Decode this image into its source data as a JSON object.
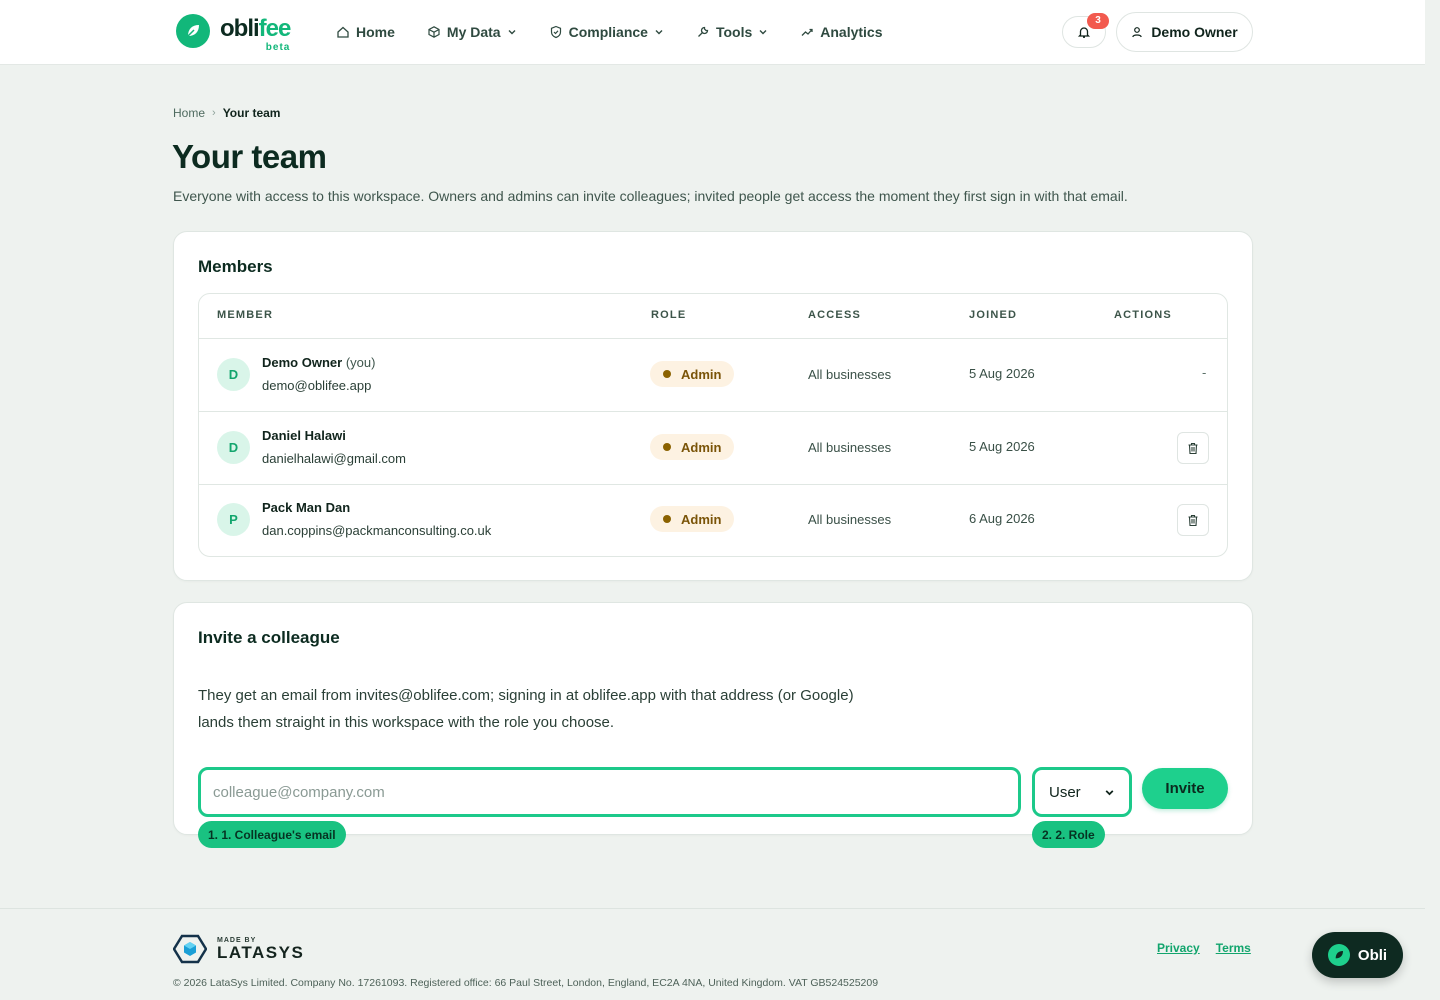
{
  "header": {
    "logo_word_a": "obli",
    "logo_word_b": "fee",
    "logo_beta": "beta",
    "nav": [
      {
        "label": "Home"
      },
      {
        "label": "My Data"
      },
      {
        "label": "Compliance"
      },
      {
        "label": "Tools"
      },
      {
        "label": "Analytics"
      }
    ],
    "notification_count": "3",
    "user_label": "Demo Owner"
  },
  "breadcrumb": {
    "home": "Home",
    "separator": "›",
    "current": "Your team"
  },
  "page": {
    "title": "Your team",
    "subtitle": "Everyone with access to this workspace. Owners and admins can invite colleagues; invited people get access the moment they first sign in with that email."
  },
  "members": {
    "title": "Members",
    "columns": [
      "MEMBER",
      "ROLE",
      "ACCESS",
      "JOINED",
      "ACTIONS"
    ],
    "rows": [
      {
        "initial": "D",
        "name": "Demo Owner",
        "you": "(you)",
        "email": "demo@oblifee.app",
        "role": "Admin",
        "access": "All businesses",
        "joined": "5 Aug 2026",
        "action": "-"
      },
      {
        "initial": "D",
        "name": "Daniel Halawi",
        "you": "",
        "email": "danielhalawi@gmail.com",
        "role": "Admin",
        "access": "All businesses",
        "joined": "5 Aug 2026",
        "action": "delete"
      },
      {
        "initial": "P",
        "name": "Pack Man Dan",
        "you": "",
        "email": "dan.coppins@packmanconsulting.co.uk",
        "role": "Admin",
        "access": "All businesses",
        "joined": "6 Aug 2026",
        "action": "delete"
      }
    ]
  },
  "invite": {
    "title": "Invite a colleague",
    "description": "They get an email from invites@oblifee.com; signing in at oblifee.app with that address (or Google) lands them straight in this workspace with the role you choose.",
    "email_placeholder": "colleague@company.com",
    "email_value": "",
    "role_selected": "User",
    "button_label": "Invite",
    "tag_email": "1. 1. Colleague's email",
    "tag_role": "2. 2. Role"
  },
  "footer": {
    "made_by": "MADE BY",
    "brand": "LATASYS",
    "links": [
      "Privacy",
      "Terms"
    ],
    "legal": "© 2026 LataSys Limited. Company No. 17261093. Registered office: 66 Paul Street, London, England, EC2A 4NA, United Kingdom. VAT GB524525209",
    "assistant_label": "Obli"
  },
  "colors": {
    "brand_green": "#12b77a",
    "accent_green": "#1ed08d",
    "dark": "#0e2a21",
    "badge_red": "#f25a4f",
    "role_pill_bg": "#fdf2e2"
  }
}
